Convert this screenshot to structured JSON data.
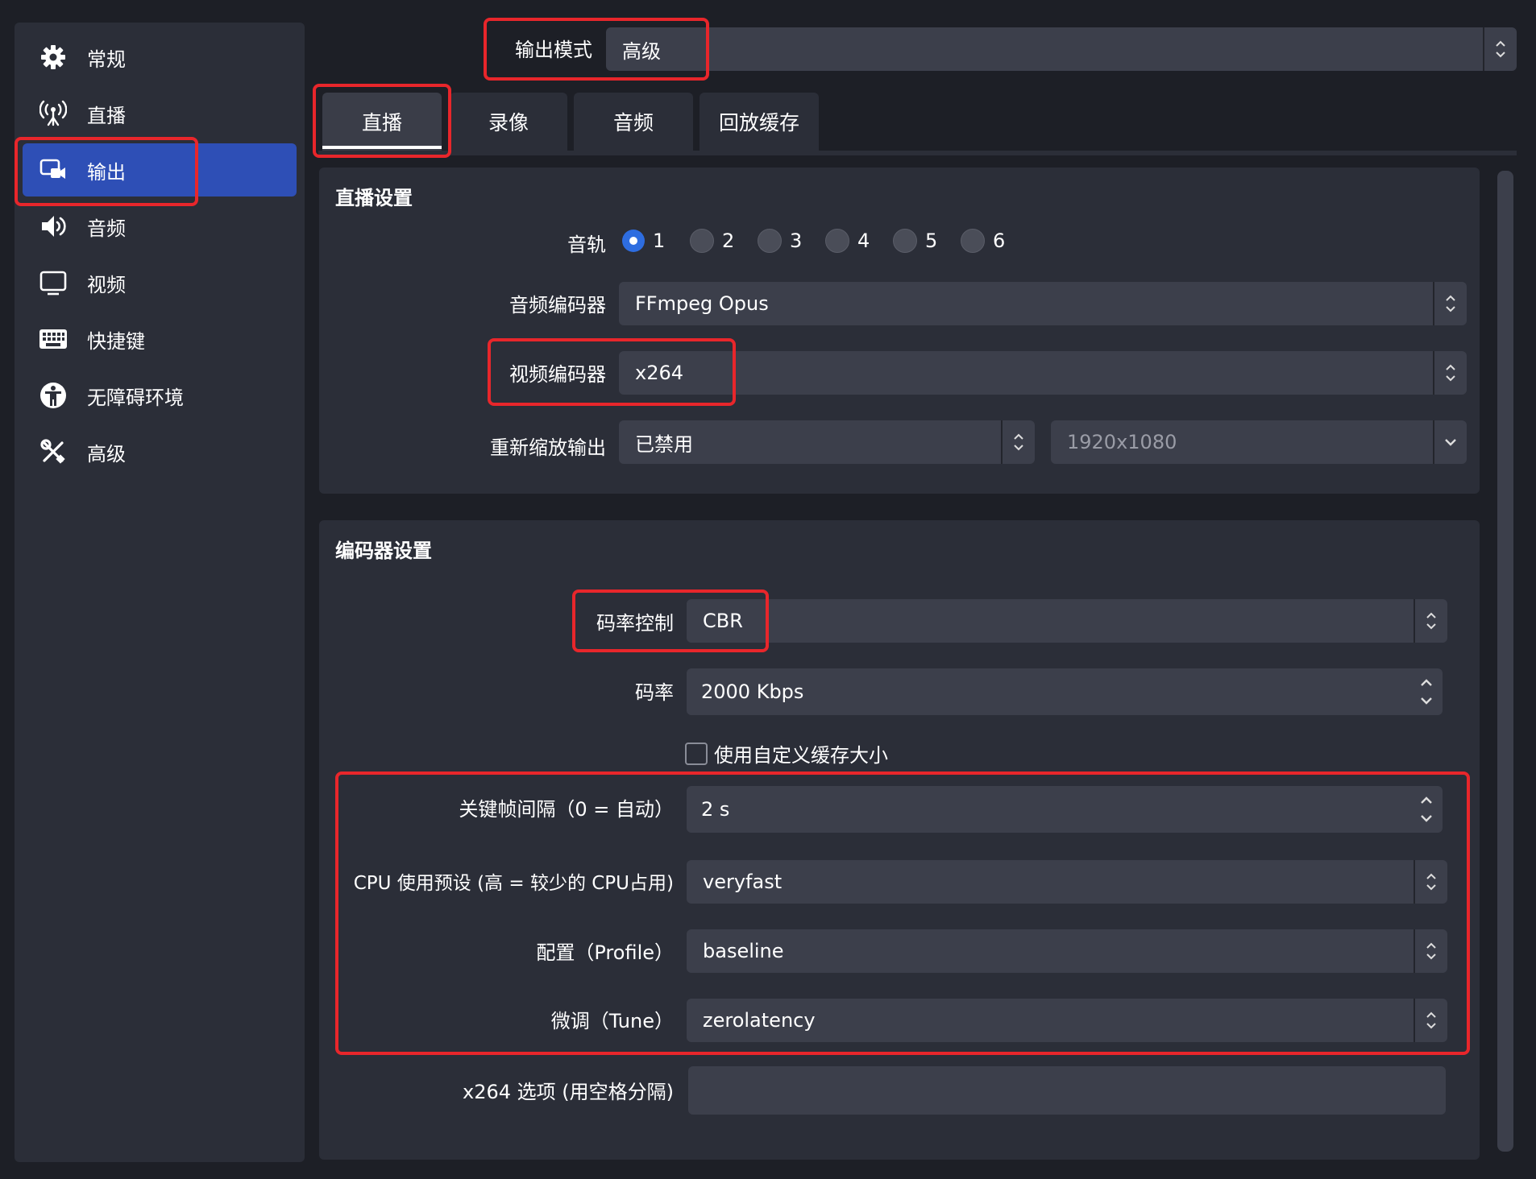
{
  "sidebar": {
    "items": [
      {
        "label": "常规",
        "icon": "gear-icon"
      },
      {
        "label": "直播",
        "icon": "antenna-icon"
      },
      {
        "label": "输出",
        "icon": "output-icon"
      },
      {
        "label": "音频",
        "icon": "speaker-icon"
      },
      {
        "label": "视频",
        "icon": "monitor-icon"
      },
      {
        "label": "快捷键",
        "icon": "keyboard-icon"
      },
      {
        "label": "无障碍环境",
        "icon": "accessibility-icon"
      },
      {
        "label": "高级",
        "icon": "tools-icon"
      }
    ],
    "active_index": 2
  },
  "output_mode": {
    "label": "输出模式",
    "value": "高级"
  },
  "tabs": [
    "直播",
    "录像",
    "音频",
    "回放缓存"
  ],
  "active_tab": 0,
  "stream_settings": {
    "title": "直播设置",
    "audio_track": {
      "label": "音轨",
      "options": [
        "1",
        "2",
        "3",
        "4",
        "5",
        "6"
      ],
      "selected": "1"
    },
    "audio_encoder": {
      "label": "音频编码器",
      "value": "FFmpeg Opus"
    },
    "video_encoder": {
      "label": "视频编码器",
      "value": "x264"
    },
    "rescale": {
      "label": "重新缩放输出",
      "value": "已禁用",
      "resolution": "1920x1080"
    }
  },
  "encoder_settings": {
    "title": "编码器设置",
    "rate_control": {
      "label": "码率控制",
      "value": "CBR"
    },
    "bitrate": {
      "label": "码率",
      "value": "2000 Kbps"
    },
    "custom_buffer": {
      "label": "使用自定义缓存大小",
      "checked": false
    },
    "keyframe": {
      "label": "关键帧间隔（0 = 自动）",
      "value": "2 s"
    },
    "cpu_preset": {
      "label": "CPU 使用预设 (高 = 较少的 CPU占用)",
      "value": "veryfast"
    },
    "profile": {
      "label": "配置（Profile）",
      "value": "baseline"
    },
    "tune": {
      "label": "微调（Tune）",
      "value": "zerolatency"
    },
    "x264_options": {
      "label": "x264 选项 (用空格分隔)",
      "value": ""
    }
  },
  "colors": {
    "accent": "#2e4fb6",
    "highlight": "#e8262b",
    "background": "#1d1f26",
    "panel": "#2b2e38",
    "field": "#3c3f4b"
  }
}
